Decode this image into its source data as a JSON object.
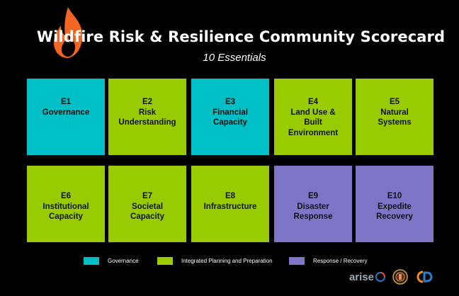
{
  "header": {
    "title": "Wildfire Risk & Resilience Community Scorecard",
    "subtitle": "10 Essentials"
  },
  "tiles": [
    {
      "code": "E1",
      "name": "Governance",
      "category": "governance"
    },
    {
      "code": "E2",
      "name": "Risk\nUnderstanding",
      "category": "integrated"
    },
    {
      "code": "E3",
      "name": "Financial\nCapacity",
      "category": "governance"
    },
    {
      "code": "E4",
      "name": "Land Use &\nBuilt\nEnvironment",
      "category": "integrated"
    },
    {
      "code": "E5",
      "name": "Natural\nSystems",
      "category": "integrated"
    },
    {
      "code": "E6",
      "name": "Institutional\nCapacity",
      "category": "integrated"
    },
    {
      "code": "E7",
      "name": "Societal\nCapacity",
      "category": "integrated"
    },
    {
      "code": "E8",
      "name": "Infrastructure",
      "category": "integrated"
    },
    {
      "code": "E9",
      "name": "Disaster\nResponse",
      "category": "response"
    },
    {
      "code": "E10",
      "name": "Expedite\nRecovery",
      "category": "response"
    }
  ],
  "legend": [
    {
      "label": "Governance",
      "color": "#00c0c7"
    },
    {
      "label": "Integrated Planning and Preparation",
      "color": "#99cc00"
    },
    {
      "label": "Response / Recovery",
      "color": "#7e74c8"
    }
  ],
  "colors": {
    "governance": "#00c0c7",
    "integrated": "#99cc00",
    "response": "#7e74c8",
    "flame": "#f26522"
  },
  "logos": {
    "arise": "arise",
    "cd": "CD"
  }
}
